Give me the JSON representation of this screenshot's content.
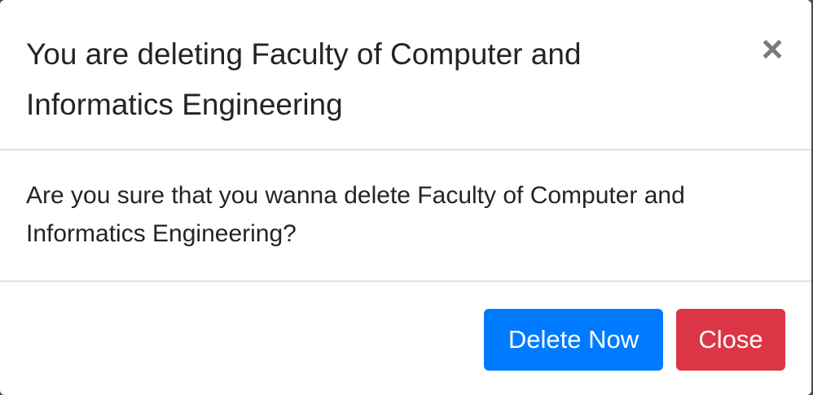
{
  "modal": {
    "title": "You are deleting Faculty of Computer and Informatics Engineering",
    "close_icon": "×",
    "body_text": "Are you sure that you wanna delete Faculty of Computer and Informatics Engineering?",
    "buttons": {
      "delete_label": "Delete Now",
      "close_label": "Close"
    }
  },
  "colors": {
    "primary": "#007bff",
    "danger": "#dc3545",
    "text": "#212529",
    "divider": "#dee2e6",
    "close_icon": "#7a7a7a"
  }
}
